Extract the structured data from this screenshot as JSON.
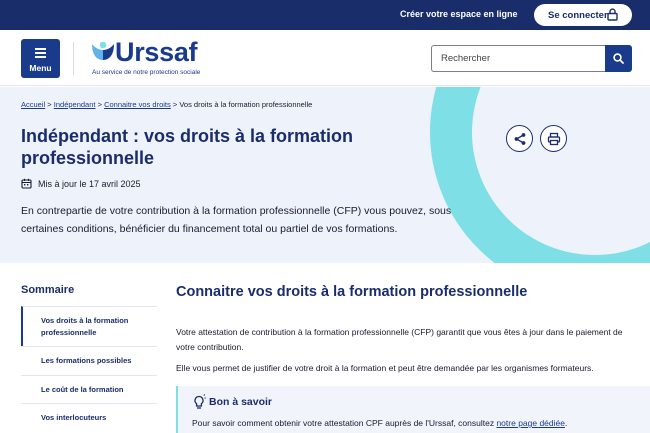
{
  "topbar": {
    "create_space": "Créer votre espace en ligne",
    "login": "Se connecter"
  },
  "header": {
    "menu_label": "Menu",
    "logo_text": "Urssaf",
    "tagline": "Au service de notre protection sociale",
    "search_placeholder": "Rechercher"
  },
  "breadcrumb": {
    "items": [
      "Accueil",
      "Indépendant",
      "Connaitre vos droits"
    ],
    "current": "Vos droits à la formation professionnelle",
    "separator": ">"
  },
  "hero": {
    "title": "Indépendant : vos droits à la formation professionnelle",
    "updated": "Mis à jour le 17 avril 2025",
    "intro": "En contrepartie de votre contribution à la formation professionnelle (CFP) vous pouvez, sous certaines conditions, bénéficier du financement total ou partiel de vos formations."
  },
  "sidebar": {
    "title": "Sommaire",
    "items": [
      {
        "label": "Vos droits à la formation professionnelle",
        "active": true
      },
      {
        "label": "Les formations possibles",
        "active": false
      },
      {
        "label": "Le coût de la formation",
        "active": false
      },
      {
        "label": "Vos interlocuteurs",
        "active": false
      }
    ]
  },
  "main": {
    "heading": "Connaitre vos droits à la formation professionnelle",
    "p1": "Votre attestation de contribution à la formation professionnelle (CFP) garantit que vous êtes à jour dans le paiement de votre contribution.",
    "p2": "Elle vous permet de justifier de votre droit à la formation et peut être demandée par les organismes formateurs.",
    "callout": {
      "title": "Bon à savoir",
      "text_before": "Pour savoir comment obtenir votre attestation CPF auprès de l'Urssaf, consultez ",
      "link": "notre page dédiée",
      "text_after": "."
    }
  },
  "colors": {
    "navy": "#1a2d6b",
    "primary": "#1a3a8c",
    "accent_teal": "#7fdfe6",
    "hero_bg": "#eef2fb"
  },
  "icons": [
    "lock-icon",
    "menu-icon",
    "urssaf-logo-icon",
    "search-icon",
    "share-icon",
    "print-icon",
    "calendar-icon",
    "lightbulb-icon"
  ]
}
